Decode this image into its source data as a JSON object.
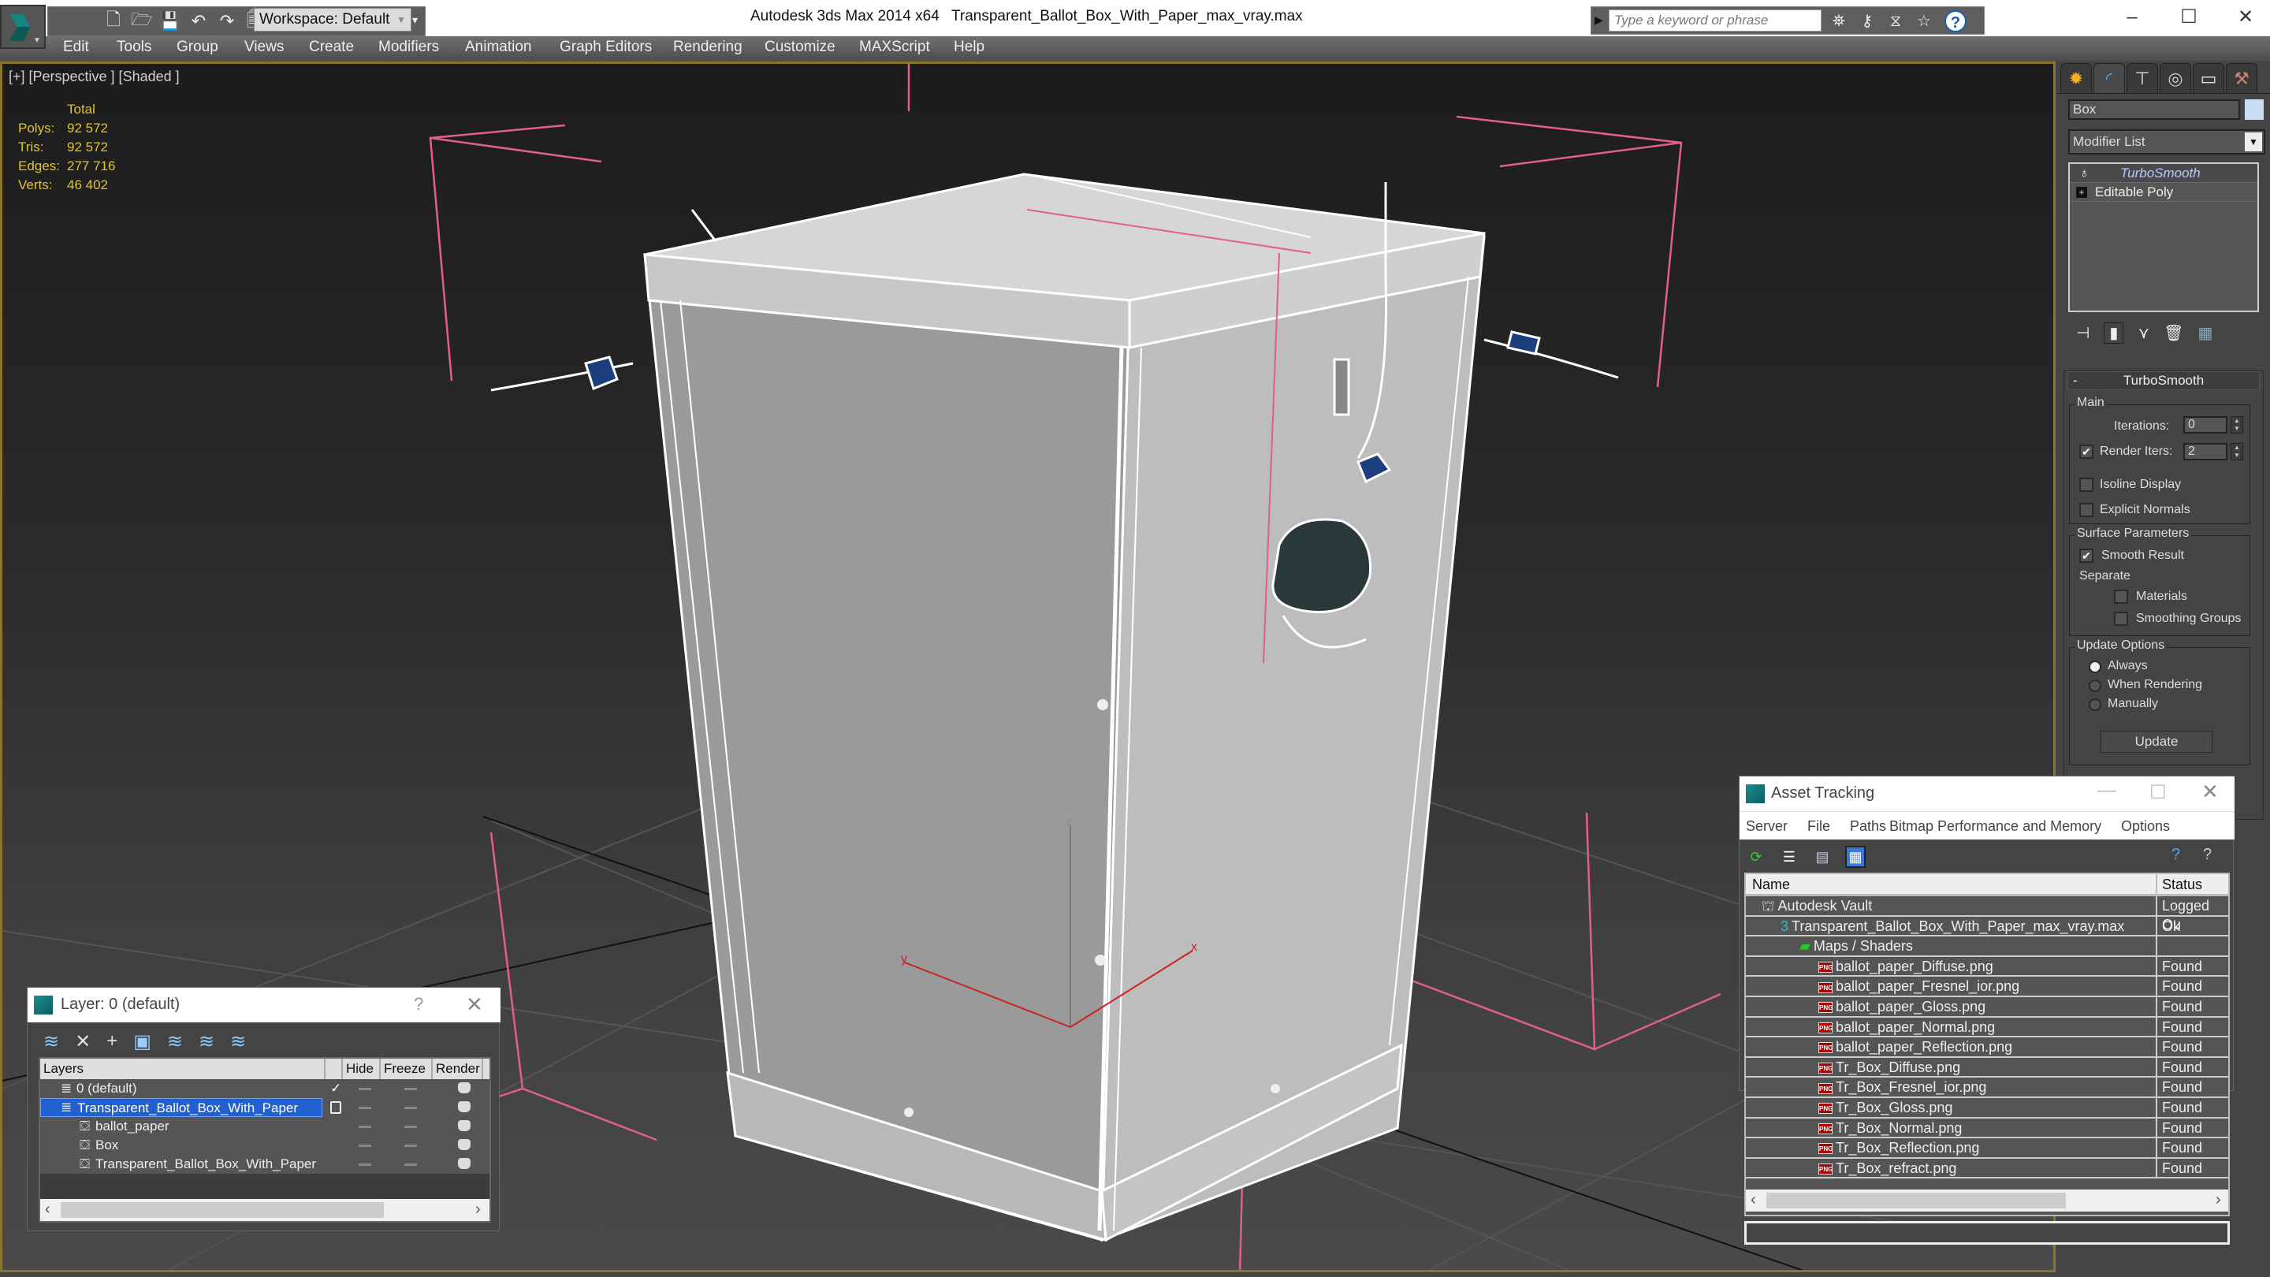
{
  "titlebar": {
    "app_title": "Autodesk 3ds Max  2014 x64",
    "file_title": "Transparent_Ballot_Box_With_Paper_max_vray.max",
    "workspace": "Workspace: Default",
    "search_placeholder": "Type a keyword or phrase",
    "qat_icons": [
      "new-file-icon",
      "open-folder-icon",
      "save-icon",
      "undo-icon",
      "redo-icon",
      "project-folder-icon"
    ],
    "infocenter_icons": [
      "binoculars-icon",
      "key-icon",
      "exchange-icon",
      "star-icon"
    ],
    "help_label": "?",
    "window_controls": {
      "minimize": "–",
      "maximize": "☐",
      "close": "✕"
    }
  },
  "menubar": {
    "items": [
      "Edit",
      "Tools",
      "Group",
      "Views",
      "Create",
      "Modifiers",
      "Animation",
      "Graph Editors",
      "Rendering",
      "Customize",
      "MAXScript",
      "Help"
    ]
  },
  "viewport": {
    "label": "[+] [Perspective ] [Shaded ]",
    "stats": {
      "header": "Total",
      "rows": [
        {
          "k": "Polys:",
          "v": "92 572"
        },
        {
          "k": "Tris:",
          "v": "92 572"
        },
        {
          "k": "Edges:",
          "v": "277 716"
        },
        {
          "k": "Verts:",
          "v": "46 402"
        }
      ]
    },
    "axes": {
      "x": "x",
      "y": "y",
      "z": "z"
    },
    "colors": {
      "stats": "#e3c32a",
      "selection_bracket": "#e0608a",
      "border": "#8a7530"
    }
  },
  "command_panel": {
    "tabs": [
      "create-icon",
      "modify-icon",
      "hierarchy-icon",
      "motion-icon",
      "display-icon",
      "utilities-icon"
    ],
    "object_name": "Box",
    "object_color": "#c8dcf4",
    "modifier_list": "Modifier List",
    "stack": [
      "TurboSmooth",
      "Editable Poly"
    ],
    "turbosmooth": {
      "title": "TurboSmooth",
      "main_label": "Main",
      "iterations_label": "Iterations:",
      "iterations_value": "0",
      "render_iters_label": "Render Iters:",
      "render_iters_value": "2",
      "render_iters_checked": true,
      "isoline_label": "Isoline Display",
      "explicit_normals_label": "Explicit Normals",
      "surface_params_label": "Surface Parameters",
      "smooth_result_label": "Smooth Result",
      "smooth_result_checked": true,
      "separate_label": "Separate",
      "materials_label": "Materials",
      "smoothing_groups_label": "Smoothing Groups",
      "update_options_label": "Update Options",
      "always_label": "Always",
      "when_rendering_label": "When Rendering",
      "manually_label": "Manually",
      "update_option_selected": "Always",
      "update_button": "Update"
    }
  },
  "layer_window": {
    "title": "Layer: 0 (default)",
    "help": "?",
    "close": "✕",
    "columns": [
      "Layers",
      "",
      "Hide",
      "Freeze",
      "Render"
    ],
    "rows": [
      {
        "name": "0 (default)",
        "current": true,
        "type": "layer"
      },
      {
        "name": "Transparent_Ballot_Box_With_Paper",
        "selected": true,
        "type": "layer"
      },
      {
        "name": "ballot_paper",
        "type": "object"
      },
      {
        "name": "Box",
        "type": "object"
      },
      {
        "name": "Transparent_Ballot_Box_With_Paper",
        "type": "object"
      }
    ]
  },
  "asset_window": {
    "title": "Asset Tracking",
    "menu": [
      "Server",
      "File",
      "Paths",
      "Bitmap Performance and Memory",
      "Options"
    ],
    "columns": {
      "name": "Name",
      "status": "Status"
    },
    "rows": [
      {
        "name": "Autodesk Vault",
        "status": "Logged Ou",
        "level": 0,
        "icon": "vault-icon"
      },
      {
        "name": "Transparent_Ballot_Box_With_Paper_max_vray.max",
        "status": "Ok",
        "level": 1,
        "icon": "max-file-icon"
      },
      {
        "name": "Maps / Shaders",
        "status": "",
        "level": 2,
        "icon": "maps-icon"
      },
      {
        "name": "ballot_paper_Diffuse.png",
        "status": "Found",
        "level": 3,
        "icon": "png-icon"
      },
      {
        "name": "ballot_paper_Fresnel_ior.png",
        "status": "Found",
        "level": 3,
        "icon": "png-icon"
      },
      {
        "name": "ballot_paper_Gloss.png",
        "status": "Found",
        "level": 3,
        "icon": "png-icon"
      },
      {
        "name": "ballot_paper_Normal.png",
        "status": "Found",
        "level": 3,
        "icon": "png-icon"
      },
      {
        "name": "ballot_paper_Reflection.png",
        "status": "Found",
        "level": 3,
        "icon": "png-icon"
      },
      {
        "name": "Tr_Box_Diffuse.png",
        "status": "Found",
        "level": 3,
        "icon": "png-icon"
      },
      {
        "name": "Tr_Box_Fresnel_ior.png",
        "status": "Found",
        "level": 3,
        "icon": "png-icon"
      },
      {
        "name": "Tr_Box_Gloss.png",
        "status": "Found",
        "level": 3,
        "icon": "png-icon"
      },
      {
        "name": "Tr_Box_Normal.png",
        "status": "Found",
        "level": 3,
        "icon": "png-icon"
      },
      {
        "name": "Tr_Box_Reflection.png",
        "status": "Found",
        "level": 3,
        "icon": "png-icon"
      },
      {
        "name": "Tr_Box_refract.png",
        "status": "Found",
        "level": 3,
        "icon": "png-icon"
      }
    ]
  }
}
